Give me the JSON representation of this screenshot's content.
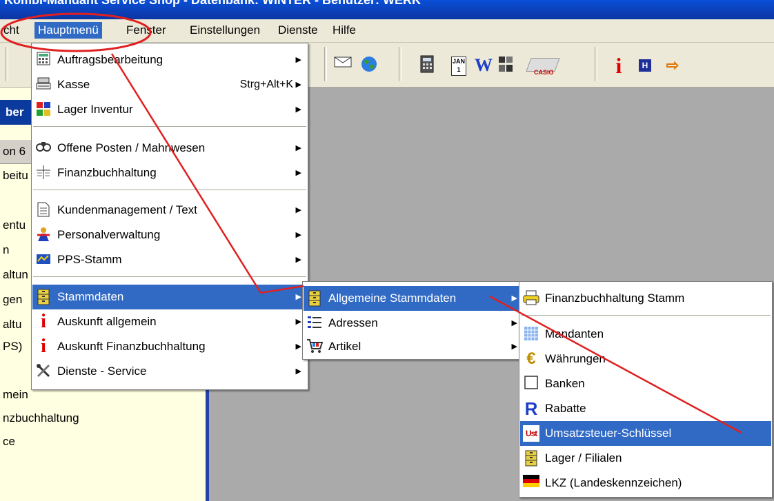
{
  "title_bar": {
    "text": "Kombi-Mandant Service Shop - Datenbank: WINTER - Benutzer: WERK"
  },
  "menubar": {
    "items": [
      "cht",
      "Hauptmenü",
      "Fenster",
      "Einstellungen",
      "Dienste",
      "Hilfe"
    ]
  },
  "toolbar": {
    "icons": [
      "print-icon",
      "mail-icon",
      "globe-icon",
      "calculator-icon",
      "calendar-icon",
      "word-icon",
      "document-icon",
      "casio-icon",
      "info-icon",
      "h-icon",
      "arrow-icon"
    ],
    "casio_label": "CASIO",
    "word_label": "W",
    "info_label": "i",
    "h_label": "H",
    "calendar_label": "JAN 1"
  },
  "left_panel": {
    "header": "ber",
    "bar": "on 6",
    "fragments": [
      "beitu",
      "entu",
      "n",
      "altun",
      "gen",
      "altu",
      "PS)",
      "mein",
      "nzbuchhaltung",
      "ce"
    ]
  },
  "main_menu": {
    "items": [
      {
        "label": "Auftragsbearbeitung",
        "accel": "",
        "icon": "calculator-icon",
        "submenu": true
      },
      {
        "label": "Kasse",
        "accel": "Strg+Alt+K",
        "icon": "cash-register-icon",
        "submenu": true
      },
      {
        "label": "Lager Inventur",
        "accel": "",
        "icon": "inventory-icon",
        "submenu": true
      },
      {
        "label": "Offene Posten / Mahnwesen",
        "accel": "",
        "icon": "binoculars-icon",
        "submenu": true
      },
      {
        "label": "Finanzbuchhaltung",
        "accel": "",
        "icon": "ledger-icon",
        "submenu": true
      },
      {
        "label": "Kundenmanagement / Text",
        "accel": "",
        "icon": "document-icon",
        "submenu": true
      },
      {
        "label": "Personalverwaltung",
        "accel": "",
        "icon": "person-icon",
        "submenu": true
      },
      {
        "label": "PPS-Stamm",
        "accel": "",
        "icon": "factory-icon",
        "submenu": true
      },
      {
        "label": "Stammdaten",
        "accel": "",
        "icon": "cabinet-icon",
        "submenu": true
      },
      {
        "label": "Auskunft allgemein",
        "accel": "",
        "icon": "info-icon",
        "submenu": true
      },
      {
        "label": "Auskunft Finanzbuchhaltung",
        "accel": "",
        "icon": "info-icon",
        "submenu": true
      },
      {
        "label": "Dienste - Service",
        "accel": "",
        "icon": "tools-icon",
        "submenu": true
      }
    ]
  },
  "stammdaten_menu": {
    "items": [
      {
        "label": "Allgemeine Stammdaten",
        "icon": "cabinet-icon"
      },
      {
        "label": "Adressen",
        "icon": "address-icon"
      },
      {
        "label": "Artikel",
        "icon": "cart-icon"
      }
    ]
  },
  "allgemeine_menu": {
    "items": [
      {
        "label": "Finanzbuchhaltung Stamm",
        "icon": "printer-icon"
      },
      {
        "label": "Mandanten",
        "icon": "grid-icon"
      },
      {
        "label": "Währungen",
        "icon": "euro-icon"
      },
      {
        "label": "Banken",
        "icon": "checkbox-icon"
      },
      {
        "label": "Rabatte",
        "icon": "r-icon"
      },
      {
        "label": "Umsatzsteuer-Schlüssel",
        "icon": "tax-icon"
      },
      {
        "label": "Lager / Filialen",
        "icon": "cabinet-icon"
      },
      {
        "label": "LKZ  (Landeskennzeichen)",
        "icon": "flag-icon"
      }
    ]
  },
  "glyphs": {
    "arrow": "▶",
    "euro": "€",
    "r": "R",
    "info": "i",
    "ust": "Ust",
    "h": "H",
    "w": "W"
  },
  "colors": {
    "highlight": "#316ac5",
    "menu_bg": "#ffffff",
    "menubar_bg": "#ece9d8",
    "annotation": "#e02020",
    "left_panel_bg": "#ffffe1"
  }
}
